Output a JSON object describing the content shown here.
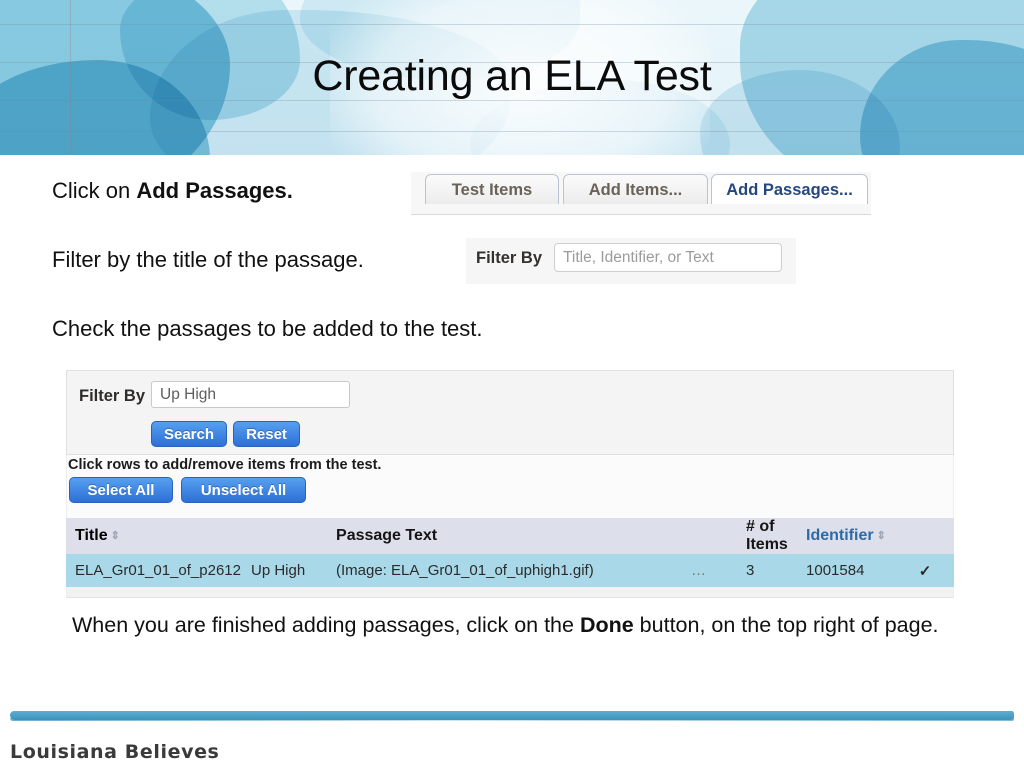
{
  "slide": {
    "title": "Creating an ELA Test",
    "instructions": [
      {
        "prefix": "Click on ",
        "bold": "Add Passages.",
        "suffix": ""
      },
      {
        "prefix": "Filter by the title of the passage.",
        "bold": "",
        "suffix": ""
      },
      {
        "prefix": "Check the passages to be added to the test.",
        "bold": "",
        "suffix": ""
      }
    ],
    "closing": {
      "prefix": "When you are finished adding passages, click on the ",
      "bold": "Done",
      "suffix": " button, on the top right of page."
    }
  },
  "tabs_screenshot": {
    "tabs": [
      {
        "label": "Test Items",
        "active": false
      },
      {
        "label": "Add Items...",
        "active": false
      },
      {
        "label": "Add Passages...",
        "active": true
      }
    ]
  },
  "filter_screenshot": {
    "label": "Filter By",
    "placeholder": "Title, Identifier, or Text",
    "value": ""
  },
  "panel": {
    "filter": {
      "label": "Filter By",
      "value": "Up High",
      "placeholder": "Title, Identifier, or Text",
      "search_label": "Search",
      "reset_label": "Reset"
    },
    "hint": "Click rows to add/remove items from the test.",
    "select_all_label": "Select All",
    "unselect_all_label": "Unselect All",
    "table": {
      "headers": [
        {
          "label": "Title",
          "sortable": true,
          "color": "#2d6aa8"
        },
        {
          "label": "Passage Text",
          "sortable": false,
          "color": "#151515"
        },
        {
          "label": "# of Items",
          "sortable": false,
          "color": "#151515"
        },
        {
          "label": "Identifier",
          "sortable": true,
          "color": "#2d6aa8"
        }
      ],
      "sort_glyph": "⇕",
      "rows": [
        {
          "title": "ELA_Gr01_01_of_p2612",
          "passage_name": "Up High",
          "passage_text": "(Image: ELA_Gr01_01_of_uphigh1.gif)",
          "ellipsis": "…",
          "num_items": "3",
          "identifier": "1001584",
          "selected_mark": "✓"
        }
      ]
    }
  },
  "footer": {
    "brand": "Louisiana Believes"
  },
  "colors": {
    "accent_blue": "#3f94bd",
    "button_blue": "#2e6fd8",
    "active_tab_text": "#24477f",
    "table_header_bg": "#dde0ea",
    "table_row_bg": "#a9d9e9",
    "sort_link": "#2d6aa8"
  }
}
